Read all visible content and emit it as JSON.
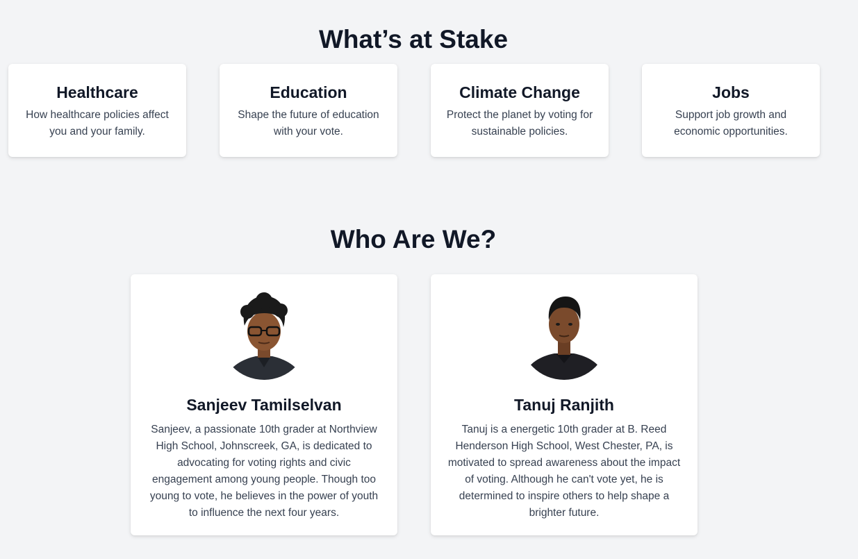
{
  "stake": {
    "title": "What’s at Stake",
    "cards": [
      {
        "title": "Healthcare",
        "text": "How healthcare policies affect you and your family."
      },
      {
        "title": "Education",
        "text": "Shape the future of education with your vote."
      },
      {
        "title": "Climate Change",
        "text": "Protect the planet by voting for sustainable policies."
      },
      {
        "title": "Jobs",
        "text": "Support job growth and economic opportunities."
      }
    ]
  },
  "who": {
    "title": "Who Are We?",
    "people": [
      {
        "name": "Sanjeev Tamilselvan",
        "bio": "Sanjeev, a passionate 10th grader at Northview High School, Johnscreek, GA, is dedicated to advocating for voting rights and civic engagement among young people. Though too young to vote, he believes in the power of youth to influence the next four years."
      },
      {
        "name": "Tanuj Ranjith",
        "bio": "Tanuj is a energetic 10th grader at B. Reed Henderson High School, West Chester, PA, is motivated to spread awareness about the impact of voting. Although he can't vote yet, he is determined to inspire others to help shape a brighter future."
      }
    ]
  }
}
